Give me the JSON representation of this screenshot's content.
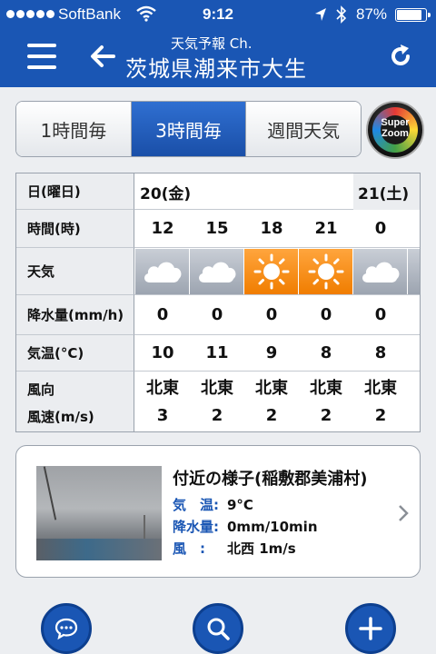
{
  "status_bar": {
    "carrier": "SoftBank",
    "time": "9:12",
    "battery_text": "87%",
    "battery_level": 0.87,
    "icons": [
      "signal-dots-icon",
      "wifi-icon",
      "location-arrow-icon",
      "bluetooth-icon",
      "battery-icon"
    ]
  },
  "header": {
    "subtitle": "天気予報 Ch.",
    "title": "茨城県潮来市大生",
    "icons": [
      "menu-icon",
      "back-arrow-icon",
      "refresh-icon"
    ]
  },
  "tabs": [
    {
      "label": "1時間毎",
      "active": false
    },
    {
      "label": "3時間毎",
      "active": true
    },
    {
      "label": "週間天気",
      "active": false
    }
  ],
  "super_zoom": {
    "line1": "Super",
    "line2": "Zoom"
  },
  "forecast": {
    "labels": {
      "day": "日(曜日)",
      "hour": "時間(時)",
      "weather": "天気",
      "precip": "降水量(mm/h)",
      "temp": "気温(°C)",
      "wind_dir": "風向",
      "wind_speed": "風速(m/s)"
    },
    "days": [
      {
        "label": "20(金)"
      },
      {
        "label": "21(土)"
      }
    ],
    "columns": [
      {
        "hour": "12",
        "weather": "cloudy",
        "precip": "0",
        "temp": "10",
        "wind_dir": "北東",
        "wind_speed": "3"
      },
      {
        "hour": "15",
        "weather": "cloudy",
        "precip": "0",
        "temp": "11",
        "wind_dir": "北東",
        "wind_speed": "2"
      },
      {
        "hour": "18",
        "weather": "sunny",
        "precip": "0",
        "temp": "9",
        "wind_dir": "北東",
        "wind_speed": "2"
      },
      {
        "hour": "21",
        "weather": "sunny",
        "precip": "0",
        "temp": "8",
        "wind_dir": "北東",
        "wind_speed": "2"
      },
      {
        "hour": "0",
        "weather": "cloudy",
        "precip": "0",
        "temp": "8",
        "wind_dir": "北東",
        "wind_speed": "2"
      }
    ],
    "colors": {
      "sunny": "#f07d00",
      "cloudy": "#9ca4b0"
    }
  },
  "nearby": {
    "title": "付近の様子(稲敷郡美浦村)",
    "rows": [
      {
        "key": "気　温:",
        "value": "9°C"
      },
      {
        "key": "降水量:",
        "value": "0mm/10min"
      },
      {
        "key": "風　:",
        "value": "北西 1m/s"
      }
    ]
  },
  "bottom_buttons": [
    "chat-bubble-icon",
    "search-icon",
    "plus-icon"
  ],
  "colors": {
    "brand": "#1a56b4",
    "active_tab": "#1a4fa8",
    "label_blue": "#1a56b4"
  }
}
